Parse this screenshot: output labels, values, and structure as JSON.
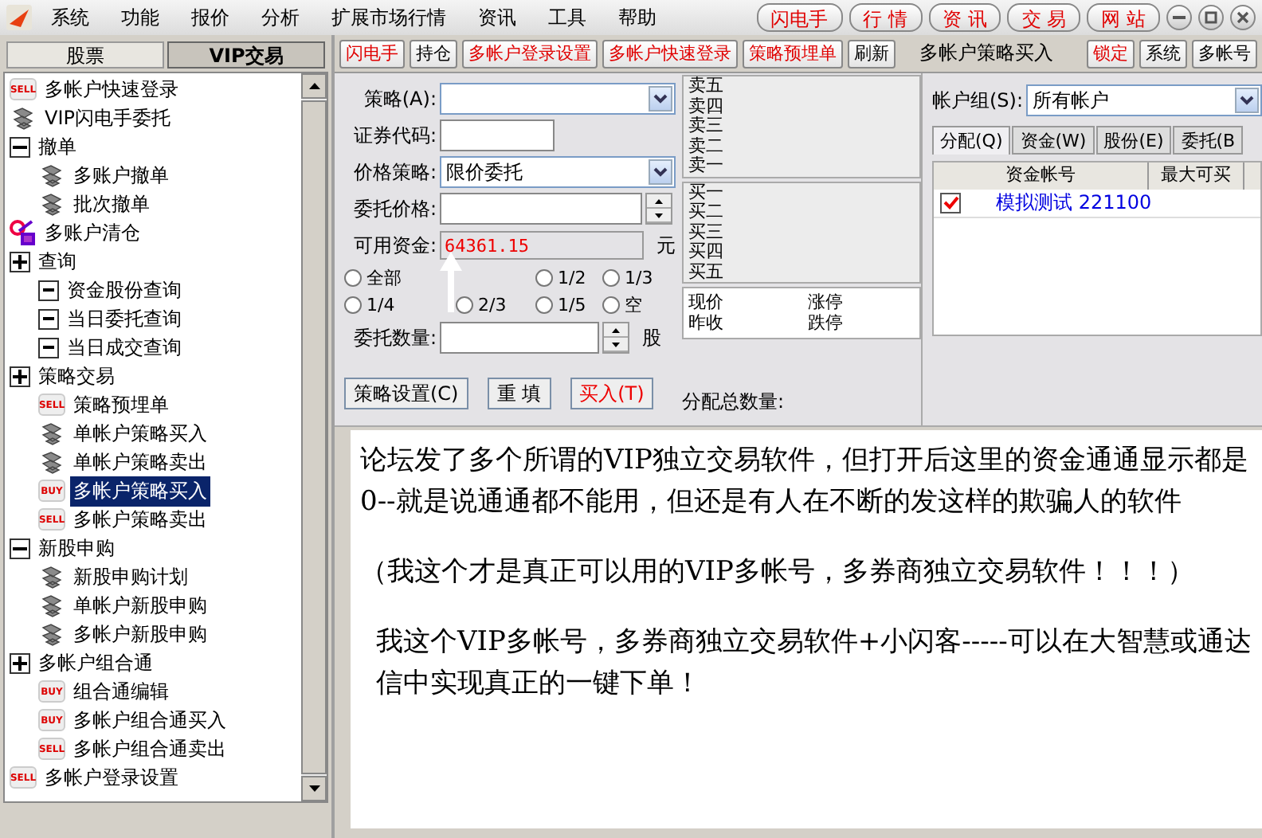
{
  "menu": [
    "系统",
    "功能",
    "报价",
    "分析",
    "扩展市场行情",
    "资讯",
    "工具",
    "帮助"
  ],
  "top_buttons": [
    "闪电手",
    "行 情",
    "资 讯",
    "交 易",
    "网 站"
  ],
  "sidebar": {
    "tabs": [
      {
        "label": "股票",
        "selected": false
      },
      {
        "label": "VIP交易",
        "selected": true
      }
    ],
    "tree": [
      {
        "label": "多帐户快速登录",
        "kind": "badge",
        "badge": "SELL",
        "selected": false
      },
      {
        "label": "VIP闪电手委托",
        "kind": "gear",
        "selected": false
      },
      {
        "label": "撤单",
        "expanded": true,
        "children": [
          {
            "label": "多账户撤单",
            "kind": "gear",
            "selected": false
          },
          {
            "label": "批次撤单",
            "kind": "gear",
            "selected": false
          }
        ]
      },
      {
        "label": "多账户清仓",
        "kind": "clear",
        "selected": false
      },
      {
        "label": "查询",
        "expanded": false,
        "children": [
          {
            "label": "资金股份查询",
            "kind": "box",
            "selected": false
          },
          {
            "label": "当日委托查询",
            "kind": "box",
            "selected": false
          },
          {
            "label": "当日成交查询",
            "kind": "box",
            "selected": false
          }
        ]
      },
      {
        "label": "策略交易",
        "expanded": false,
        "children": [
          {
            "label": "策略预埋单",
            "kind": "badge",
            "badge": "SELL",
            "selected": false
          },
          {
            "label": "单帐户策略买入",
            "kind": "gear",
            "selected": false
          },
          {
            "label": "单帐户策略卖出",
            "kind": "gear",
            "selected": false
          },
          {
            "label": "多帐户策略买入",
            "kind": "badge",
            "badge": "BUY",
            "selected": true
          },
          {
            "label": "多帐户策略卖出",
            "kind": "badge",
            "badge": "SELL",
            "selected": false
          }
        ]
      },
      {
        "label": "新股申购",
        "expanded": true,
        "children": [
          {
            "label": "新股申购计划",
            "kind": "gear",
            "selected": false
          },
          {
            "label": "单帐户新股申购",
            "kind": "gear",
            "selected": false
          },
          {
            "label": "多帐户新股申购",
            "kind": "gear",
            "selected": false
          }
        ]
      },
      {
        "label": "多帐户组合通",
        "expanded": false,
        "children": [
          {
            "label": "组合通编辑",
            "kind": "badge",
            "badge": "BUY",
            "selected": false
          },
          {
            "label": "多帐户组合通买入",
            "kind": "badge",
            "badge": "BUY",
            "selected": false
          },
          {
            "label": "多帐户组合通卖出",
            "kind": "badge",
            "badge": "SELL",
            "selected": false
          }
        ]
      },
      {
        "label": "多帐户登录设置",
        "kind": "badge",
        "badge": "SELL",
        "selected": false
      }
    ]
  },
  "toolbar": {
    "left": [
      {
        "label": "闪电手",
        "kind": "red"
      },
      {
        "label": "持仓",
        "kind": "plain"
      },
      {
        "label": "多帐户登录设置",
        "kind": "red"
      },
      {
        "label": "多帐户快速登录",
        "kind": "red"
      },
      {
        "label": "策略预埋单",
        "kind": "red"
      },
      {
        "label": "刷新",
        "kind": "plain"
      }
    ],
    "title": "多帐户策略买入",
    "right": [
      {
        "label": "锁定",
        "kind": "red"
      },
      {
        "label": "系统",
        "kind": "plain"
      },
      {
        "label": "多帐号",
        "kind": "plain"
      }
    ]
  },
  "form": {
    "strategy_label": "策略(A):",
    "code_label": "证券代码:",
    "price_strategy_label": "价格策略:",
    "price_strategy_value": "限价委托",
    "price_label": "委托价格:",
    "funds_label": "可用资金:",
    "funds_value": "64361.15",
    "funds_unit": "元",
    "ratios": [
      {
        "label": "全部",
        "selected": false
      },
      {
        "label": "1/2",
        "selected": false
      },
      {
        "label": "1/3",
        "selected": false
      },
      {
        "label": "1/4",
        "selected": false
      },
      {
        "label": "2/3",
        "selected": false
      },
      {
        "label": "1/5",
        "selected": false
      },
      {
        "label": "空",
        "selected": false
      }
    ],
    "qty_label": "委托数量:",
    "qty_unit": "股",
    "buttons": [
      {
        "label": "策略设置(C)",
        "kind": "plain"
      },
      {
        "label": "重 填",
        "kind": "plain"
      },
      {
        "label": "买入(T)",
        "kind": "red"
      }
    ],
    "total_label": "分配总数量:"
  },
  "quote": {
    "asks": [
      "卖五",
      "卖四",
      "卖三",
      "卖二",
      "卖一"
    ],
    "bids": [
      "买一",
      "买二",
      "买三",
      "买四",
      "买五"
    ],
    "info": [
      "现价",
      "涨停",
      "昨收",
      "跌停"
    ]
  },
  "accounts": {
    "group_label": "帐户组(S):",
    "group_value": "所有帐户",
    "tabs": [
      {
        "label": "分配(Q)",
        "selected": true
      },
      {
        "label": "资金(W)",
        "selected": false
      },
      {
        "label": "股份(E)",
        "selected": false
      },
      {
        "label": "委托(B",
        "selected": false
      }
    ],
    "columns": [
      "资金帐号",
      "最大可买"
    ],
    "rows": [
      {
        "checked": true,
        "account": "模拟测试 221100"
      }
    ]
  },
  "annotation": [
    "论坛发了多个所谓的VIP独立交易软件，但打开后这里的资金通通显示都是0--就是说通通都不能用，但还是有人在不断的发这样的欺骗人的软件",
    "（我这个才是真正可以用的VIP多帐号，多券商独立交易软件！！！）",
    "我这个VIP多帐号，多券商独立交易软件+小闪客-----可以在大智慧或通达信中实现真正的一键下单！"
  ]
}
